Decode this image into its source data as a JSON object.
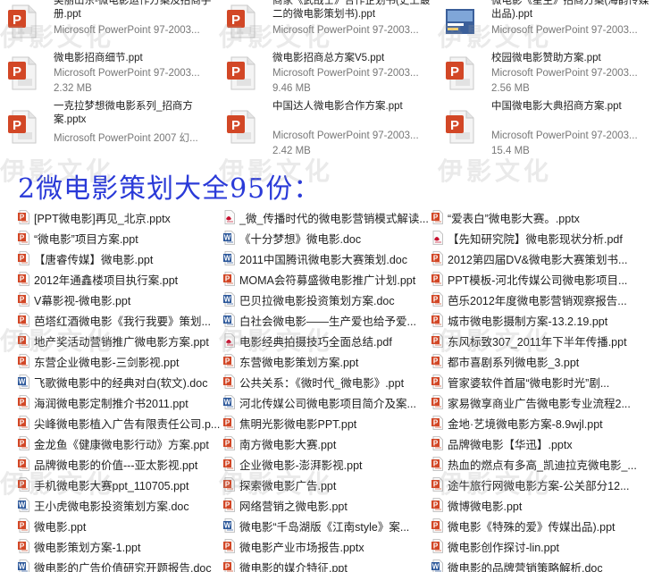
{
  "tiles": [
    {
      "name": "美丽山东-微电影运作方案及招商手册.ppt",
      "type": "Microsoft PowerPoint 97-2003...",
      "size": "",
      "kind": "ppt"
    },
    {
      "name": "商家《武战士》合作企划书(史上最二的微电影策划书).ppt",
      "type": "Microsoft PowerPoint 97-2003...",
      "size": "",
      "kind": "ppt"
    },
    {
      "name": "微电影《星生》招商方案(海韵传媒出品).ppt",
      "type": "Microsoft PowerPoint 97-2003...",
      "size": "",
      "kind": "thumb"
    },
    {
      "name": "微电影招商细节.ppt",
      "type": "Microsoft PowerPoint 97-2003...",
      "size": "2.32 MB",
      "kind": "ppt"
    },
    {
      "name": "微电影招商总方案V5.ppt",
      "type": "Microsoft PowerPoint 97-2003...",
      "size": "9.46 MB",
      "kind": "ppt"
    },
    {
      "name": "校园微电影赞助方案.ppt",
      "type": "Microsoft PowerPoint 97-2003...",
      "size": "2.56 MB",
      "kind": "ppt"
    },
    {
      "name": "一克拉梦想微电影系列_招商方案.pptx",
      "type": "Microsoft PowerPoint 2007 幻...",
      "size": "",
      "kind": "ppt"
    },
    {
      "name": "中国达人微电影合作方案.ppt",
      "type": "Microsoft PowerPoint 97-2003...",
      "size": "2.42 MB",
      "kind": "ppt"
    },
    {
      "name": "中国微电影大典招商方案.ppt",
      "type": "Microsoft PowerPoint 97-2003...",
      "size": "15.4 MB",
      "kind": "ppt"
    }
  ],
  "heading": "2微电影策划大全95份：",
  "watermark": "伊影文化",
  "files": [
    [
      {
        "name": "[PPT微电影]再见_北京.pptx",
        "kind": "ppt"
      },
      {
        "name": "“微电影”项目方案.ppt",
        "kind": "ppt"
      },
      {
        "name": "【唐睿传媒】微电影.ppt",
        "kind": "ppt"
      },
      {
        "name": "2012年通鑫楼项目执行案.ppt",
        "kind": "ppt"
      },
      {
        "name": "V幕影视-微电影.ppt",
        "kind": "ppt"
      },
      {
        "name": "芭塔红酒微电影《我行我要》策划...",
        "kind": "ppt"
      },
      {
        "name": "地产奖活动营销推广微电影方案.ppt",
        "kind": "ppt"
      },
      {
        "name": "东营企业微电影-三剑影视.ppt",
        "kind": "ppt"
      },
      {
        "name": "飞歌微电影中的经典对白(软文).doc",
        "kind": "doc"
      },
      {
        "name": "海润微电影定制推介书2011.ppt",
        "kind": "ppt"
      },
      {
        "name": "尖峰微电影植入广告有限责任公司.p...",
        "kind": "ppt"
      },
      {
        "name": "金龙鱼《健康微电影行动》方案.ppt",
        "kind": "ppt"
      },
      {
        "name": "品牌微电影的价值---亚太影视.ppt",
        "kind": "ppt"
      },
      {
        "name": "手机微电影大赛ppt_110705.ppt",
        "kind": "ppt"
      },
      {
        "name": "王小虎微电影投资策划方案.doc",
        "kind": "doc"
      },
      {
        "name": "微电影.ppt",
        "kind": "ppt"
      },
      {
        "name": "微电影策划方案-1.ppt",
        "kind": "ppt"
      },
      {
        "name": "微电影的广告价值研究开题报告.doc",
        "kind": "doc"
      }
    ],
    [
      {
        "name": "_微_传播时代的微电影营销模式解读...",
        "kind": "pdf"
      },
      {
        "name": "《十分梦想》微电影.doc",
        "kind": "doc"
      },
      {
        "name": "2011中国腾讯微电影大赛策划.doc",
        "kind": "doc"
      },
      {
        "name": "MOMA会符募盛微电影推广计划.ppt",
        "kind": "ppt"
      },
      {
        "name": "巴贝拉微电影投资策划方案.doc",
        "kind": "doc"
      },
      {
        "name": "白社会微电影——生产爱也给予爱...",
        "kind": "doc"
      },
      {
        "name": "电影经典拍摄技巧全面总结.pdf",
        "kind": "pdf"
      },
      {
        "name": "东营微电影策划方案.ppt",
        "kind": "ppt"
      },
      {
        "name": "公共关系：《微时代_微电影》.ppt",
        "kind": "ppt"
      },
      {
        "name": "河北传媒公司微电影项目简介及案...",
        "kind": "doc"
      },
      {
        "name": "焦明光影微电影PPT.ppt",
        "kind": "ppt"
      },
      {
        "name": "南方微电影大赛.ppt",
        "kind": "ppt"
      },
      {
        "name": "企业微电影-澎湃影视.ppt",
        "kind": "ppt"
      },
      {
        "name": "探索微电影广告.ppt",
        "kind": "ppt"
      },
      {
        "name": "网络营销之微电影.ppt",
        "kind": "ppt"
      },
      {
        "name": "微电影“千岛湖版《江南style》案...",
        "kind": "doc"
      },
      {
        "name": "微电影产业市场报告.pptx",
        "kind": "ppt"
      },
      {
        "name": "微电影的媒介特征.ppt",
        "kind": "ppt"
      }
    ],
    [
      {
        "name": "“爱表白”微电影大赛。.pptx",
        "kind": "ppt"
      },
      {
        "name": "【先知研究院】微电影现状分析.pdf",
        "kind": "pdf"
      },
      {
        "name": "2012第四届DV&微电影大赛策划书...",
        "kind": "ppt"
      },
      {
        "name": "PPT模板-河北传媒公司微电影项目...",
        "kind": "ppt"
      },
      {
        "name": "芭乐2012年度微电影营销观察报告...",
        "kind": "ppt"
      },
      {
        "name": "城市微电影摄制方案-13.2.19.ppt",
        "kind": "ppt"
      },
      {
        "name": "东风标致307_2011年下半年传播.ppt",
        "kind": "ppt"
      },
      {
        "name": "都市喜剧系列微电影_3.ppt",
        "kind": "ppt"
      },
      {
        "name": "管家婆软件首届“微电影时光”剧...",
        "kind": "ppt"
      },
      {
        "name": "家易微享商业广告微电影专业流程2...",
        "kind": "ppt"
      },
      {
        "name": "金地·艺境微电影方案-8.9wjl.ppt",
        "kind": "ppt"
      },
      {
        "name": "品牌微电影【华迅】.pptx",
        "kind": "ppt"
      },
      {
        "name": "热血的燃点有多高_凯迪拉克微电影_...",
        "kind": "ppt"
      },
      {
        "name": "途牛旅行网微电影方案-公关部分12...",
        "kind": "ppt"
      },
      {
        "name": "微博微电影.ppt",
        "kind": "ppt"
      },
      {
        "name": "微电影《特殊的爱》传媒出品).ppt",
        "kind": "ppt"
      },
      {
        "name": "微电影创作探讨-lin.ppt",
        "kind": "ppt"
      },
      {
        "name": "微电影的品牌营销策略解析.doc",
        "kind": "doc"
      }
    ]
  ],
  "colors": {
    "ppt": "#d24726",
    "doc": "#2b579a",
    "pdf": "#c8102e",
    "heading": "#2a3ad8"
  }
}
